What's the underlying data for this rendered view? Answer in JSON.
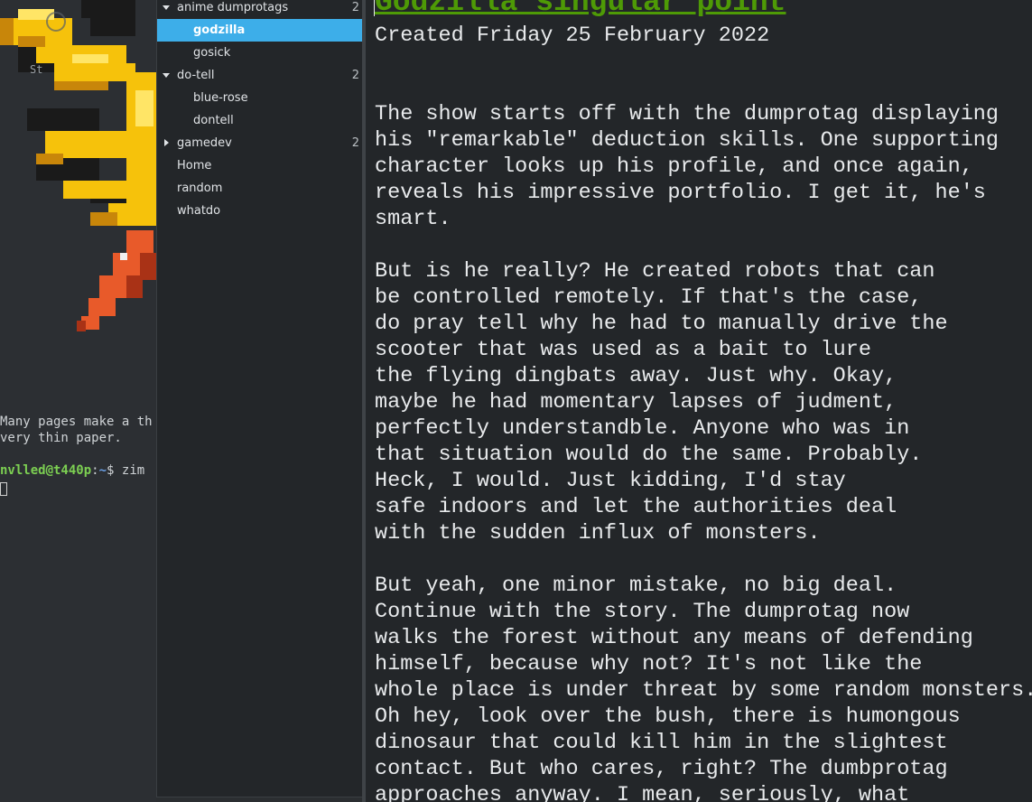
{
  "terminal": {
    "partial_label": "St",
    "output_lines": [
      "Many pages make a th",
      "very thin paper."
    ],
    "prompt_user": "nvlled@t440p",
    "prompt_sep": ":",
    "prompt_path": "~",
    "prompt_symbol": "$",
    "command": "zim"
  },
  "sidebar": {
    "items": [
      {
        "label": "anime dumprotags",
        "count": "2",
        "expanded": true,
        "level": 0
      },
      {
        "label": "godzilla",
        "selected": true,
        "level": 1
      },
      {
        "label": "gosick",
        "level": 1
      },
      {
        "label": "do-tell",
        "count": "2",
        "expanded": true,
        "level": 0
      },
      {
        "label": "blue-rose",
        "level": 1
      },
      {
        "label": "dontell",
        "level": 1
      },
      {
        "label": "gamedev",
        "count": "2",
        "expanded": false,
        "level": 0
      },
      {
        "label": "Home",
        "level": 0
      },
      {
        "label": "random",
        "level": 0
      },
      {
        "label": "whatdo",
        "level": 0
      }
    ]
  },
  "editor": {
    "heading": "Godzilla singular point",
    "created": "Created Friday 25 February 2022",
    "body_lines": [
      "",
      "",
      "The show starts off with the dumprotag displaying",
      "his \"remarkable\" deduction skills. One supporting",
      "character looks up his profile, and once again,",
      "reveals his impressive portfolio. I get it, he's",
      "smart.",
      "",
      "But is he really? He created robots that can",
      "be controlled remotely. If that's the case,",
      "do pray tell why he had to manually drive the",
      "scooter that was used as a bait to lure",
      "the flying dingbats away. Just why. Okay,",
      "maybe he had momentary lapses of judment,",
      "perfectly understandble. Anyone who was in",
      "that situation would do the same. Probably.",
      "Heck, I would. Just kidding, I'd stay",
      "safe indoors and let the authorities deal",
      "with the sudden influx of monsters.",
      "",
      "But yeah, one minor mistake, no big deal.",
      "Continue with the story. The dumprotag now",
      "walks the forest without any means of defending",
      "himself, because why not? It's not like the",
      "whole place is under threat by some random monsters.",
      "Oh hey, look over the bush, there is humongous",
      "dinosaur that could kill him in the slightest",
      "contact. But who cares, right? The dumbprotag",
      "approaches anyway. I mean, seriously, what"
    ]
  },
  "colors": {
    "accent": "#3daee9",
    "heading": "#4e9a06",
    "background": "#232629",
    "prompt_user": "#7ccf52",
    "prompt_path": "#6aa0e6"
  }
}
